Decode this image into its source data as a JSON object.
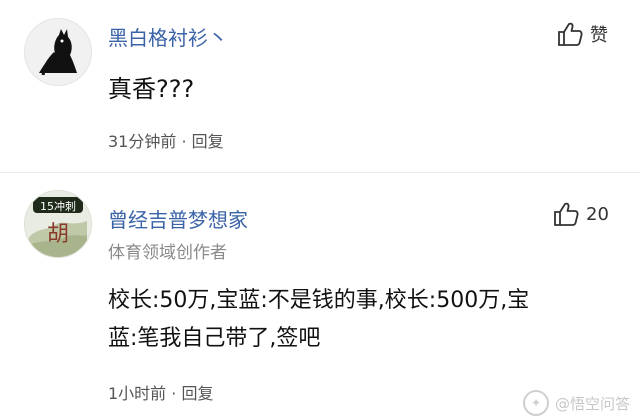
{
  "comments": [
    {
      "username": "黑白格衬衫丶",
      "text": "真香???",
      "meta_time": "31分钟前",
      "meta_dot": "·",
      "reply_label": "回复",
      "like_label": "赞",
      "avatar_icon": "cat-silhouette-icon"
    },
    {
      "username": "曾经吉普梦想家",
      "subtitle": "体育领域创作者",
      "text_line1": "校长:50万,宝蓝:不是钱的事,校长:500万,宝",
      "text_line2": "蓝:笔我自己带了,签吧",
      "meta_time": "1小时前",
      "meta_dot": "·",
      "reply_label": "回复",
      "like_count": "20",
      "avatar_badge": "15冲刺",
      "avatar_char": "胡",
      "avatar_icon": "landscape-avatar-icon"
    }
  ],
  "watermark": {
    "text": "@悟空问答",
    "icon": "wukong-logo-icon"
  },
  "colors": {
    "username": "#3a63a8",
    "meta": "#555555",
    "subtitle": "#8a8a8a"
  }
}
